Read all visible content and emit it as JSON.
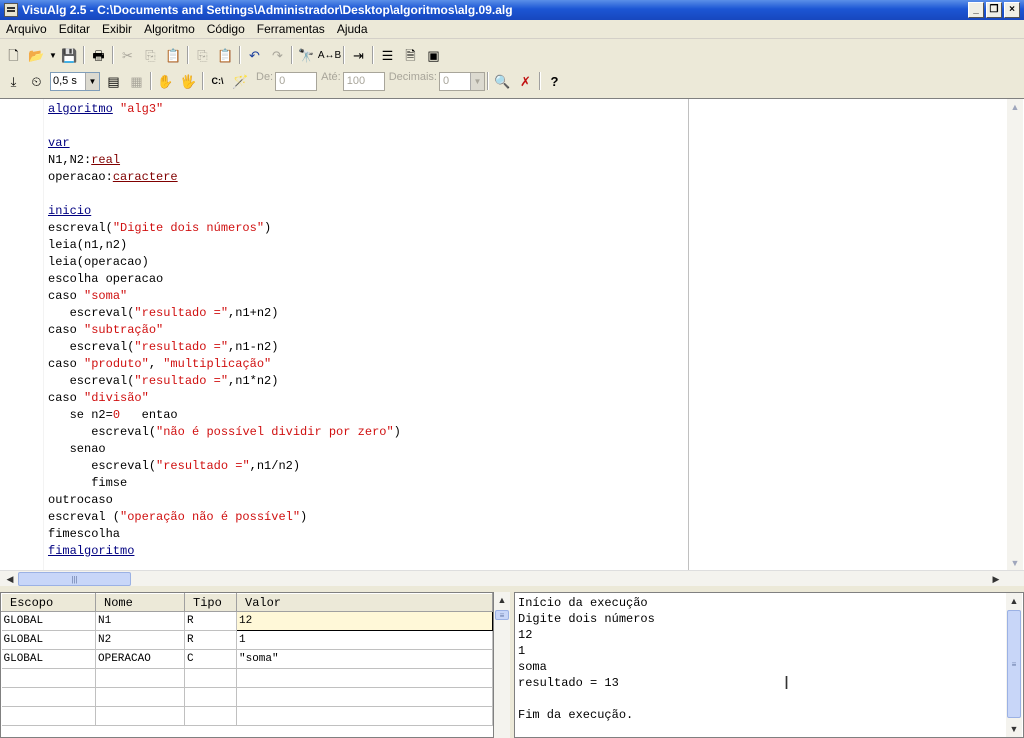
{
  "window": {
    "title": "VisuAlg 2.5 - C:\\Documents and Settings\\Administrador\\Desktop\\algoritmos\\alg.09.alg"
  },
  "menu": [
    "Arquivo",
    "Editar",
    "Exibir",
    "Algoritmo",
    "Código",
    "Ferramentas",
    "Ajuda"
  ],
  "toolbar2": {
    "speed": "0,5 s",
    "de_label": "De:",
    "de_value": "0",
    "ate_label": "Até:",
    "ate_value": "100",
    "decimais_label": "Decimais:",
    "decimais_value": "0"
  },
  "code_lines": [
    [
      {
        "t": "algoritmo",
        "c": "kw"
      },
      {
        "t": " "
      },
      {
        "t": "\"alg3\"",
        "c": "st"
      }
    ],
    [],
    [
      {
        "t": "var",
        "c": "kw"
      }
    ],
    [
      {
        "t": "N1,N2:"
      },
      {
        "t": "real",
        "c": "ty"
      }
    ],
    [
      {
        "t": "operacao:"
      },
      {
        "t": "caractere",
        "c": "ty"
      }
    ],
    [],
    [
      {
        "t": "inicio",
        "c": "kw"
      }
    ],
    [
      {
        "t": "escreval("
      },
      {
        "t": "\"Digite dois números\"",
        "c": "st"
      },
      {
        "t": ")"
      }
    ],
    [
      {
        "t": "leia(n1,n2)"
      }
    ],
    [
      {
        "t": "leia(operacao)"
      }
    ],
    [
      {
        "t": "escolha operacao"
      }
    ],
    [
      {
        "t": "caso "
      },
      {
        "t": "\"soma\"",
        "c": "st"
      }
    ],
    [
      {
        "t": "   escreval("
      },
      {
        "t": "\"resultado =\"",
        "c": "st"
      },
      {
        "t": ",n1+n2)"
      }
    ],
    [
      {
        "t": "caso "
      },
      {
        "t": "\"subtração\"",
        "c": "st"
      }
    ],
    [
      {
        "t": "   escreval("
      },
      {
        "t": "\"resultado =\"",
        "c": "st"
      },
      {
        "t": ",n1-n2)"
      }
    ],
    [
      {
        "t": "caso "
      },
      {
        "t": "\"produto\"",
        "c": "st"
      },
      {
        "t": ", "
      },
      {
        "t": "\"multiplicação\"",
        "c": "st"
      }
    ],
    [
      {
        "t": "   escreval("
      },
      {
        "t": "\"resultado =\"",
        "c": "st"
      },
      {
        "t": ",n1*n2)"
      }
    ],
    [
      {
        "t": "caso "
      },
      {
        "t": "\"divisão\"",
        "c": "st"
      }
    ],
    [
      {
        "t": "   se n2="
      },
      {
        "t": "0",
        "c": "nm"
      },
      {
        "t": "   entao"
      }
    ],
    [
      {
        "t": "      escreval("
      },
      {
        "t": "\"não é possível dividir por zero\"",
        "c": "st"
      },
      {
        "t": ")"
      }
    ],
    [
      {
        "t": "   senao"
      }
    ],
    [
      {
        "t": "      escreval("
      },
      {
        "t": "\"resultado =\"",
        "c": "st"
      },
      {
        "t": ",n1/n2)"
      }
    ],
    [
      {
        "t": "      fimse"
      }
    ],
    [
      {
        "t": "outrocaso"
      }
    ],
    [
      {
        "t": "escreval ("
      },
      {
        "t": "\"operação não é possível\"",
        "c": "st"
      },
      {
        "t": ")"
      }
    ],
    [
      {
        "t": "fimescolha"
      }
    ],
    [
      {
        "t": "fimalgoritmo",
        "c": "kw"
      }
    ]
  ],
  "vars_table": {
    "headers": [
      "Escopo",
      "Nome",
      "Tipo",
      "Valor"
    ],
    "rows": [
      [
        "GLOBAL",
        "N1",
        "R",
        "12"
      ],
      [
        "GLOBAL",
        "N2",
        "R",
        "1"
      ],
      [
        "GLOBAL",
        "OPERACAO",
        "C",
        "\"soma\""
      ],
      [
        "",
        "",
        "",
        ""
      ],
      [
        "",
        "",
        "",
        ""
      ],
      [
        "",
        "",
        "",
        ""
      ]
    ]
  },
  "output_lines": [
    "Início da execução",
    "Digite dois números",
    "12",
    "1",
    "soma",
    "resultado = 13",
    "",
    "Fim da execução."
  ],
  "icons": [
    "new-file-icon",
    "open-folder-icon",
    "save-icon",
    "print-icon",
    "cut-icon",
    "copy-icon",
    "paste-icon",
    "binoculars-icon",
    "help-icon"
  ]
}
